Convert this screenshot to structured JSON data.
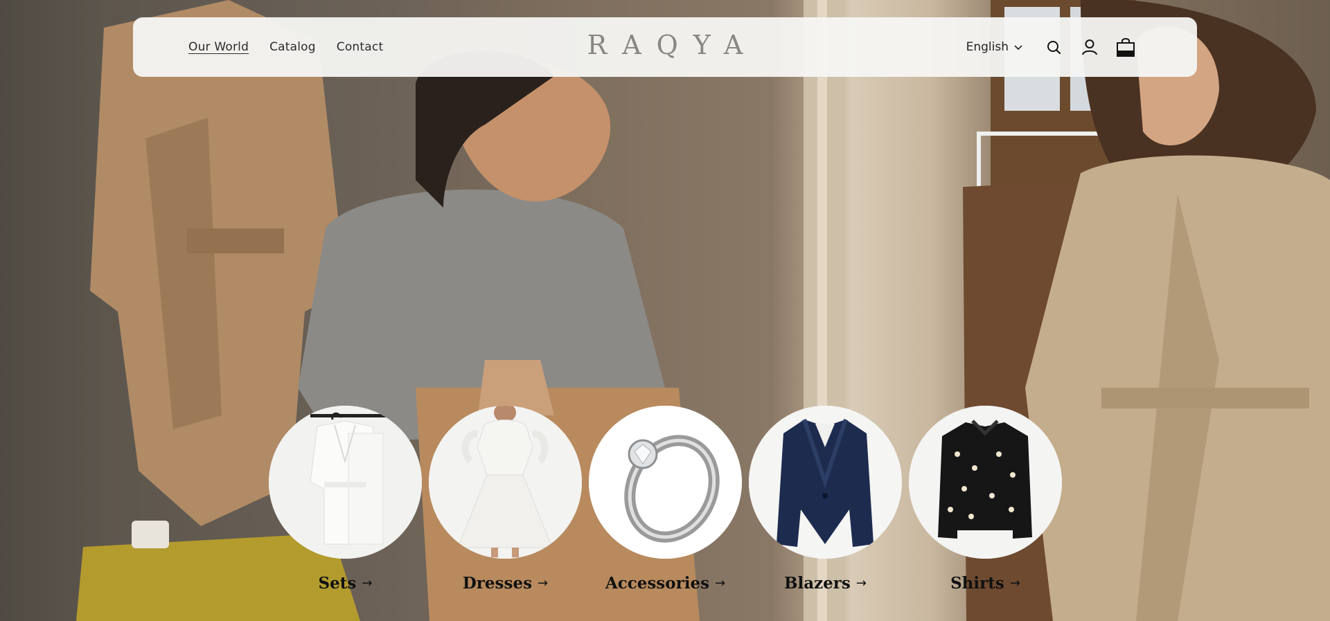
{
  "brand": {
    "logo_text": "RAQYA"
  },
  "nav": {
    "items": [
      {
        "label": "Our World",
        "active": true
      },
      {
        "label": "Catalog"
      },
      {
        "label": "Contact"
      }
    ]
  },
  "header_utils": {
    "language": "English",
    "icons": [
      "chevron-down-icon",
      "search-icon",
      "account-icon",
      "cart-bag-icon"
    ]
  },
  "categories": [
    {
      "label": "Sets",
      "arrow": "→",
      "image": "white-suit-set"
    },
    {
      "label": "Dresses",
      "arrow": "→",
      "image": "white-midi-dress"
    },
    {
      "label": "Accessories",
      "arrow": "→",
      "image": "silver-diamond-ring"
    },
    {
      "label": "Blazers",
      "arrow": "→",
      "image": "navy-blazer"
    },
    {
      "label": "Shirts",
      "arrow": "→",
      "image": "black-embellished-shirt"
    }
  ],
  "colors": {
    "header_bg": "#f6f5f3",
    "text": "#2b2b2b",
    "logo": "#8b8680",
    "label": "#111111"
  }
}
